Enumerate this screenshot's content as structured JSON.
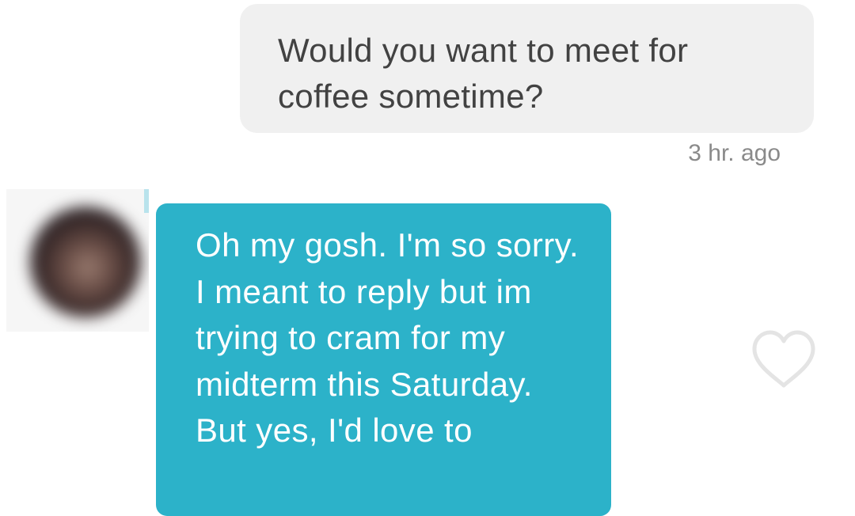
{
  "messages": {
    "outgoing": {
      "text": "Would you want to meet for coffee sometime?",
      "timestamp": "3 hr. ago"
    },
    "incoming": {
      "text": "Oh my gosh. I'm so sorry. I meant to reply but im trying to cram for my midterm this Saturday. But yes, I'd love to",
      "avatar": "blurred-profile-photo"
    }
  },
  "icons": {
    "like": "heart-outline-icon"
  },
  "colors": {
    "incoming_bubble": "#2cb2c9",
    "outgoing_bubble": "#f0f0f0",
    "outgoing_text": "#424242",
    "timestamp": "#8a8a8a",
    "heart_outline": "#e4e4e4"
  }
}
